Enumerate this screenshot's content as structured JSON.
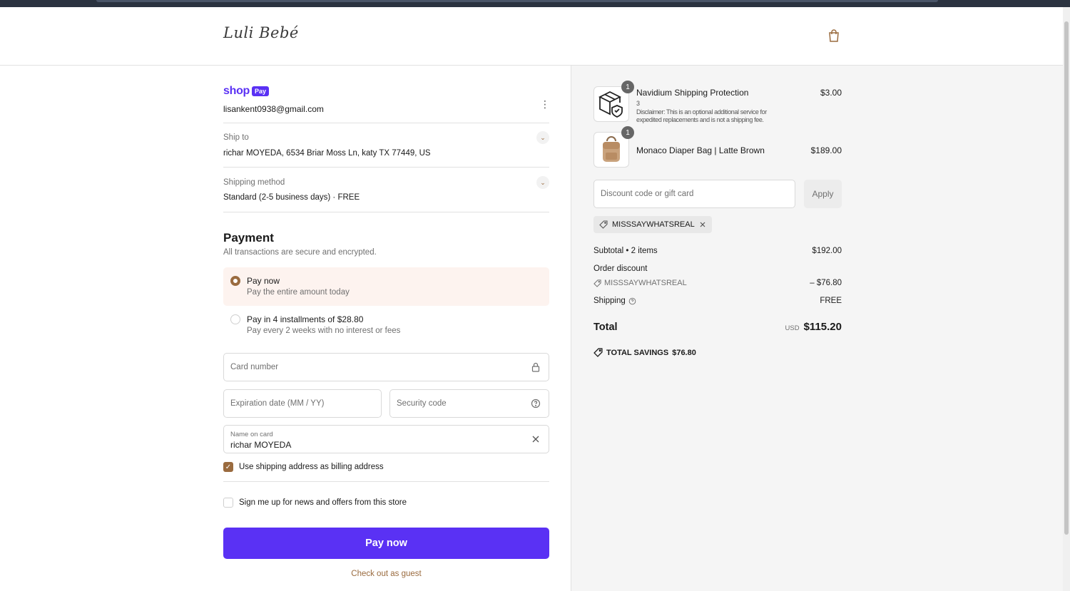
{
  "brand": {
    "logo_text": "Luli Bebé"
  },
  "header": {
    "cart_icon": "shopping-bag-icon"
  },
  "shop_pay": {
    "word": "shop",
    "badge": "Pay",
    "email": "lisankent0938@gmail.com"
  },
  "ship_to": {
    "label": "Ship to",
    "value": "richar MOYEDA, 6534 Briar Moss Ln, katy TX 77449, US"
  },
  "shipping_method": {
    "label": "Shipping method",
    "value": "Standard (2-5 business days) · FREE"
  },
  "payment": {
    "title": "Payment",
    "subtitle": "All transactions are secure and encrypted.",
    "options": [
      {
        "title": "Pay now",
        "sub": "Pay the entire amount today",
        "selected": true
      },
      {
        "title": "Pay in 4 installments of $28.80",
        "sub": "Pay every 2 weeks with no interest or fees",
        "selected": false
      }
    ],
    "card_number_placeholder": "Card number",
    "expiration_placeholder": "Expiration date (MM / YY)",
    "security_placeholder": "Security code",
    "name_label": "Name on card",
    "name_value": "richar MOYEDA",
    "billing_checkbox": "Use shipping address as billing address",
    "billing_checked": true,
    "newsletter_checkbox": "Sign me up for news and offers from this store",
    "newsletter_checked": false,
    "pay_button": "Pay now",
    "guest_link": "Check out as guest"
  },
  "cart": {
    "items": [
      {
        "name": "Navidium Shipping Protection",
        "variant": "3",
        "disclaimer": "Disclaimer: This is an optional additional service for expedited replacements and is not a shipping fee.",
        "price": "$3.00",
        "qty": "1"
      },
      {
        "name": "Monaco Diaper Bag | Latte Brown",
        "price": "$189.00",
        "qty": "1"
      }
    ],
    "discount_placeholder": "Discount code or gift card",
    "apply_label": "Apply",
    "applied_code": "MISSSAYWHATSREAL",
    "subtotal_label": "Subtotal • 2 items",
    "subtotal_value": "$192.00",
    "order_discount_label": "Order discount",
    "order_discount_code": "MISSSAYWHATSREAL",
    "order_discount_value": "– $76.80",
    "shipping_label": "Shipping",
    "shipping_value": "FREE",
    "total_label": "Total",
    "currency": "USD",
    "total_value": "$115.20",
    "savings_label": "TOTAL SAVINGS",
    "savings_value": "$76.80"
  },
  "colors": {
    "accent": "#9a6b3f",
    "shop_pay": "#5a31f4",
    "selected_bg": "#fdf3ef"
  }
}
